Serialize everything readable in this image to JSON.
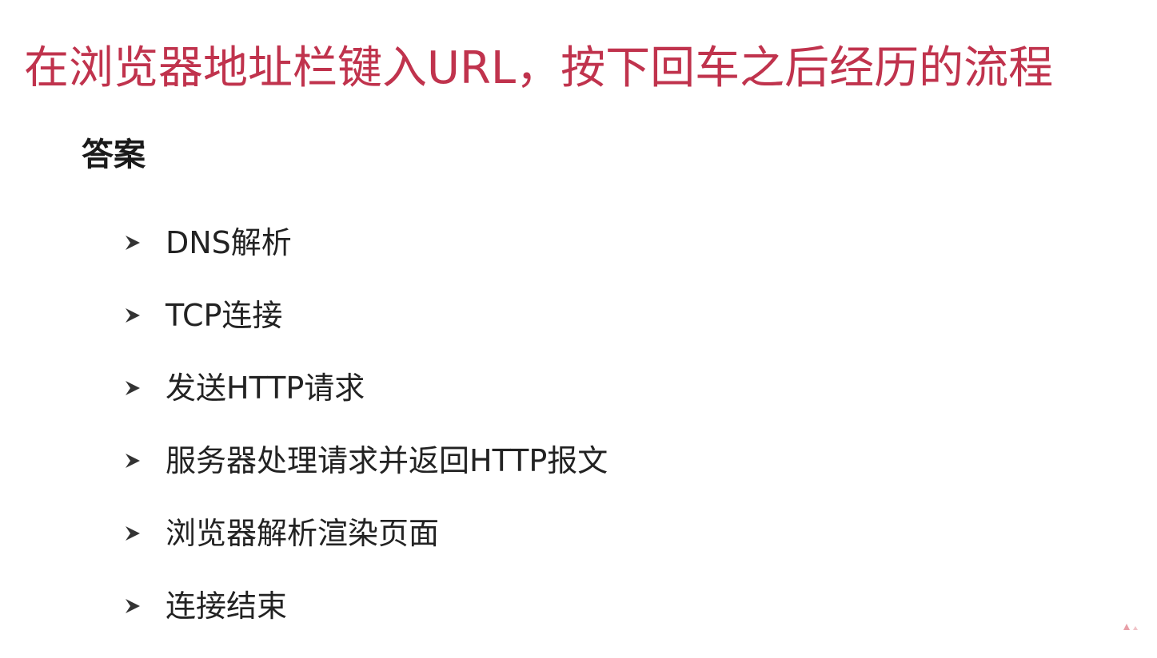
{
  "slide": {
    "title": "在浏览器地址栏键入URL，按下回车之后经历的流程",
    "subtitle": "答案",
    "bullet_icon": "arrowhead-bullet-icon",
    "items": [
      {
        "label": "DNS解析"
      },
      {
        "label": "TCP连接"
      },
      {
        "label": "发送HTTP请求"
      },
      {
        "label": "服务器处理请求并返回HTTP报文"
      },
      {
        "label": "浏览器解析渲染页面"
      },
      {
        "label": "连接结束"
      }
    ]
  },
  "colors": {
    "title": "#c0334d",
    "text": "#222222",
    "background": "#ffffff"
  }
}
